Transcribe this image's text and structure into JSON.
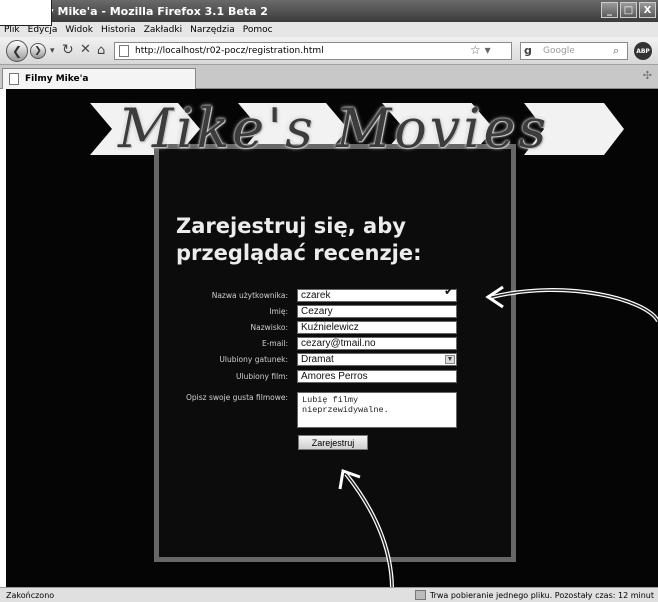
{
  "window": {
    "title": "Filmy Mike'a - Mozilla Firefox 3.1 Beta 2",
    "buttons": [
      "_",
      "□",
      "X"
    ]
  },
  "menubar": [
    "Plik",
    "Edycja",
    "Widok",
    "Historia",
    "Zakładki",
    "Narzędzia",
    "Pomoc"
  ],
  "navbar": {
    "url": "http://localhost/r02-pocz/registration.html",
    "search_placeholder": "Google",
    "search_engine": "g",
    "addon_label": "ABP"
  },
  "tab": {
    "label": "Filmy Mike'a"
  },
  "page": {
    "logo": "Mike's Movies",
    "heading_line1": "Zarejestruj się, aby",
    "heading_line2": "przeglądać recenzje:",
    "form": {
      "username_label": "Nazwa użytkownika:",
      "username_value": "czarek",
      "firstname_label": "Imię:",
      "firstname_value": "Cezary",
      "lastname_label": "Nazwisko:",
      "lastname_value": "Kuźnielewicz",
      "email_label": "E-mail:",
      "email_value": "cezary@tmail.no",
      "genre_label": "Ulubiony gatunek:",
      "genre_value": "Dramat",
      "film_label": "Ulubiony film:",
      "film_value": "Amores Perros",
      "taste_label": "Opisz swoje gusta filmowe:",
      "taste_value": "Lubię filmy\nnieprzewidywalne.",
      "submit_label": "Zarejestruj"
    }
  },
  "statusbar": {
    "left": "Zakończono",
    "right": "Trwa pobieranie jednego pliku. Pozostały czas: 12 minut"
  },
  "colors": {
    "page_background": "#050505",
    "frame": "#676767",
    "heading": "#ececec"
  }
}
